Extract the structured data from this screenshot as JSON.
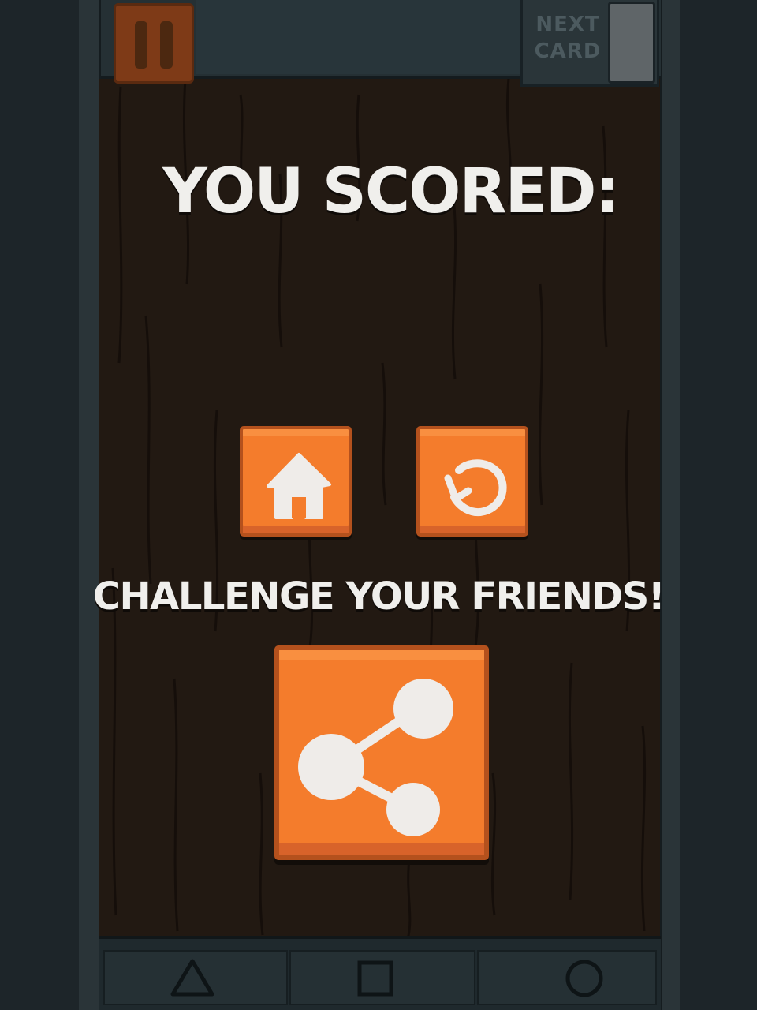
{
  "hud": {
    "pause_icon": "pause-icon",
    "next_card_label": "NEXT\nCARD",
    "next_card_line1": "NEXT",
    "next_card_line2": "CARD"
  },
  "result": {
    "title": "YOU SCORED:",
    "score": ""
  },
  "actions": {
    "home_icon": "home-icon",
    "replay_icon": "replay-icon",
    "challenge_text": "CHALLENGE YOUR FRIENDS!",
    "share_icon": "share-icon"
  },
  "navbar": {
    "items": [
      {
        "icon": "triangle-back-icon"
      },
      {
        "icon": "square-recents-icon"
      },
      {
        "icon": "circle-home-icon"
      }
    ]
  },
  "colors": {
    "accent": "#f47c2c",
    "accent_dark": "#b4511d",
    "wood": "#221912",
    "text": "#f0efec",
    "frame": "#2a3438"
  }
}
